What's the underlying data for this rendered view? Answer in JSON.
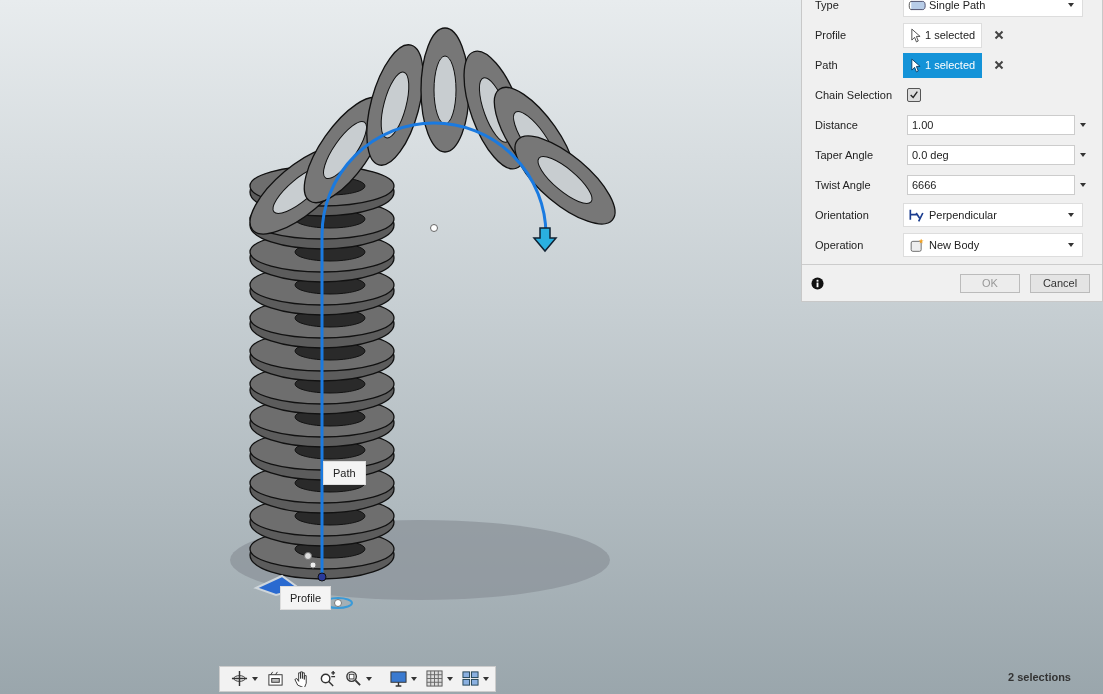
{
  "canvas": {
    "labels": [
      {
        "kind": "path",
        "text": "Path"
      },
      {
        "kind": "profile",
        "text": "Profile"
      }
    ]
  },
  "dialog": {
    "rows": [
      {
        "kind": "dropdown",
        "label": "Type",
        "value": "Single Path"
      },
      {
        "kind": "selection",
        "label": "Profile",
        "value": "1 selected",
        "selected": false
      },
      {
        "kind": "selection",
        "label": "Path",
        "value": "1 selected",
        "selected": true
      },
      {
        "kind": "checkbox",
        "label": "Chain Selection",
        "checked": true
      },
      {
        "kind": "input",
        "label": "Distance",
        "value": "1.00"
      },
      {
        "kind": "input",
        "label": "Taper Angle",
        "value": "0.0 deg"
      },
      {
        "kind": "input",
        "label": "Twist Angle",
        "value": "6666"
      },
      {
        "kind": "dropdown",
        "label": "Orientation",
        "value": "Perpendicular"
      },
      {
        "kind": "dropdown",
        "label": "Operation",
        "value": "New Body"
      }
    ],
    "buttons": [
      {
        "label": "OK",
        "disabled": true
      },
      {
        "label": "Cancel",
        "disabled": false
      }
    ]
  },
  "status_bar": {
    "selections": "2 selections"
  }
}
